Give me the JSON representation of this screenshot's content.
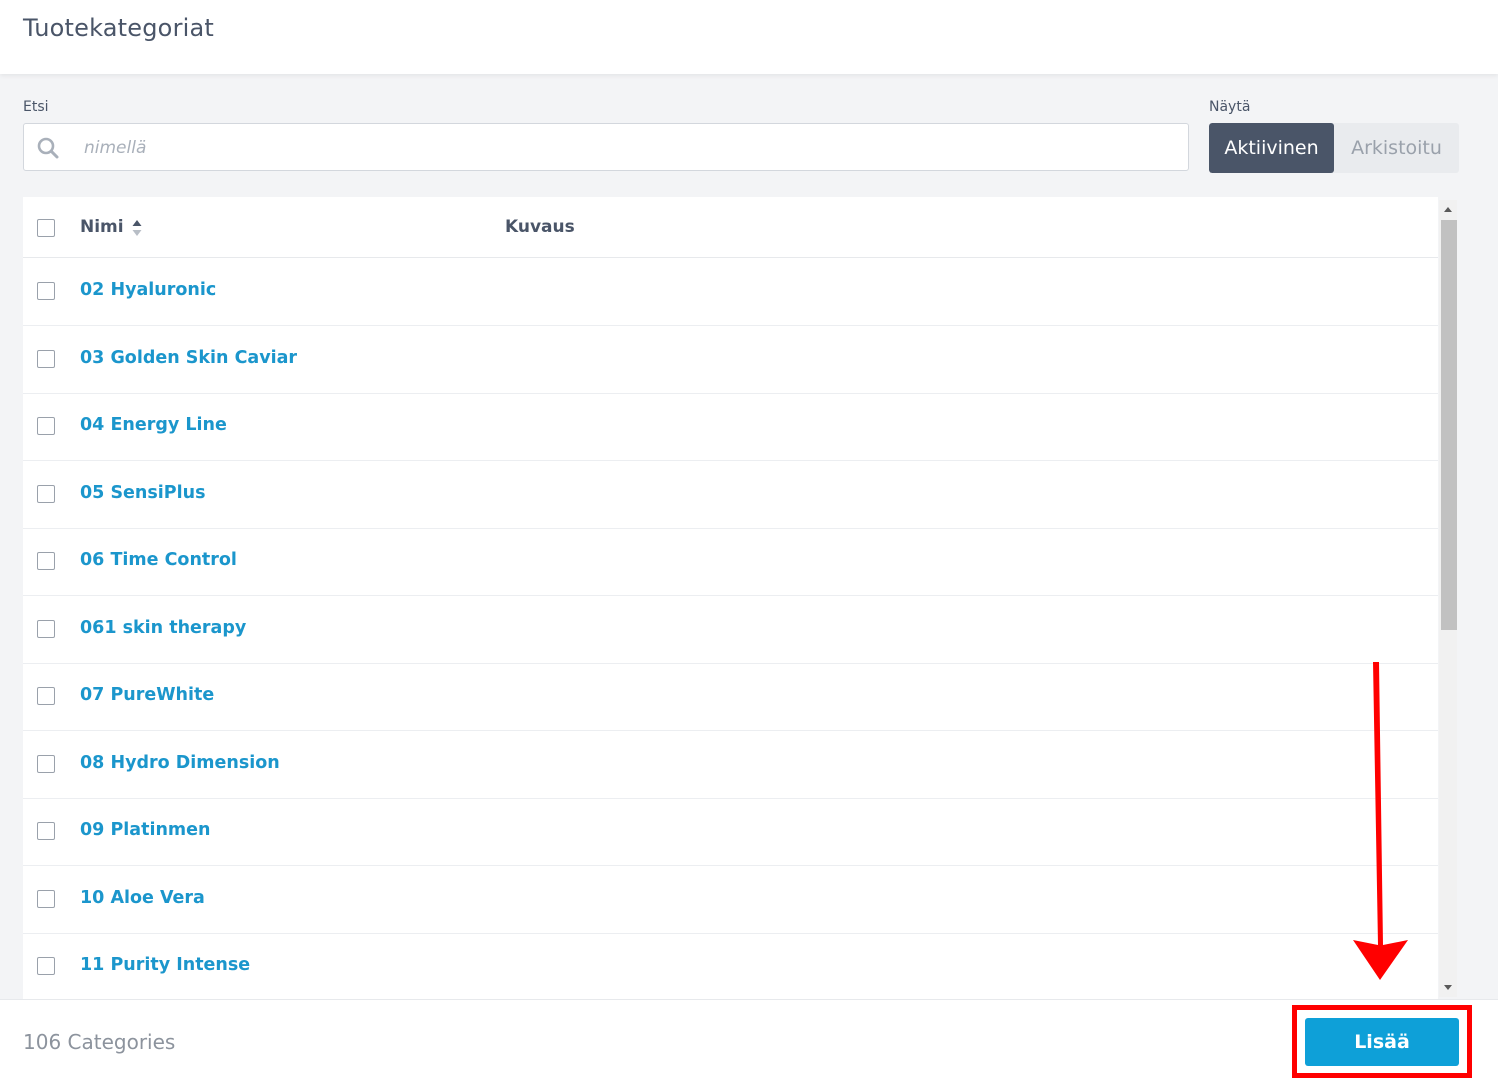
{
  "header": {
    "title": "Tuotekategoriat"
  },
  "filters": {
    "search_label": "Etsi",
    "search_placeholder": "nimellä",
    "search_value": "",
    "show_label": "Näytä",
    "toggle_active": "Aktiivinen",
    "toggle_archived": "Arkistoitu"
  },
  "table": {
    "columns": {
      "name": "Nimi",
      "description": "Kuvaus"
    },
    "rows": [
      {
        "name": "02 Hyaluronic",
        "description": ""
      },
      {
        "name": "03 Golden Skin Caviar",
        "description": ""
      },
      {
        "name": "04 Energy Line",
        "description": ""
      },
      {
        "name": "05 SensiPlus",
        "description": ""
      },
      {
        "name": "06 Time Control",
        "description": ""
      },
      {
        "name": "061 skin therapy",
        "description": ""
      },
      {
        "name": "07 PureWhite",
        "description": ""
      },
      {
        "name": "08 Hydro Dimension",
        "description": ""
      },
      {
        "name": "09 Platinmen",
        "description": ""
      },
      {
        "name": "10 Aloe Vera",
        "description": ""
      },
      {
        "name": "11 Purity Intense",
        "description": ""
      }
    ]
  },
  "footer": {
    "count": "106 Categories",
    "add_label": "Lisää"
  },
  "colors": {
    "link": "#1b96cc",
    "primary_button": "#0ea0d8",
    "toggle_active_bg": "#4a5568",
    "annotation": "#ff0000"
  },
  "icons": {
    "search": "search-icon",
    "sort": "sort-icon",
    "annotation_arrow": "arrow-down-icon"
  }
}
